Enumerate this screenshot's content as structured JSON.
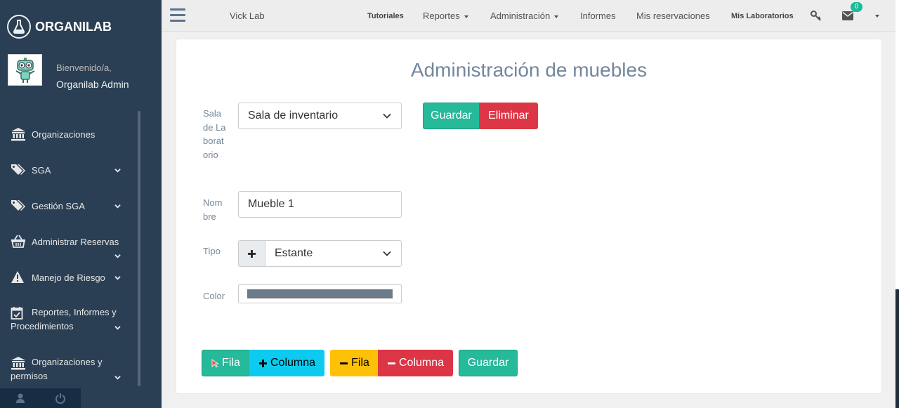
{
  "sidebar": {
    "brand": "ORGANILAB",
    "welcome": "Bienvenido/a,",
    "username": "Organilab Admin",
    "items": [
      {
        "label": "Organizaciones"
      },
      {
        "label": "SGA"
      },
      {
        "label": "Gestión SGA"
      },
      {
        "label": "Administrar Reservas"
      },
      {
        "label": "Manejo de Riesgo"
      },
      {
        "label": "Reportes, Informes y Procedimientos"
      },
      {
        "label": "Organizaciones y permisos"
      }
    ]
  },
  "topnav": {
    "lab": "Vick Lab",
    "tutoriales": "Tutoriales",
    "reportes": "Reportes",
    "administracion": "Administración",
    "informes": "Informes",
    "reservaciones": "Mis reservaciones",
    "laboratorios": "Mis Laboratorios",
    "messages_count": "0"
  },
  "page": {
    "title": "Administración de muebles",
    "form": {
      "sala_label": "Sala de Laboratorio",
      "sala_value": "Sala de inventario",
      "nombre_label": "Nombre",
      "nombre_value": "Mueble 1",
      "tipo_label": "Tipo",
      "tipo_value": "Estante",
      "color_label": "Color",
      "color_value": "#6c7a89"
    },
    "buttons": {
      "guardar": "Guardar",
      "eliminar": "Eliminar",
      "add_fila": "Fila",
      "add_columna": "Columna",
      "remove_fila": "Fila",
      "remove_columna": "Columna",
      "guardar_bottom": "Guardar"
    }
  },
  "colors": {
    "sidebar": "#2a3f54",
    "green": "#26b99a",
    "red": "#dc3545",
    "cyan": "#0dcaf0",
    "yellow": "#ffc107"
  }
}
